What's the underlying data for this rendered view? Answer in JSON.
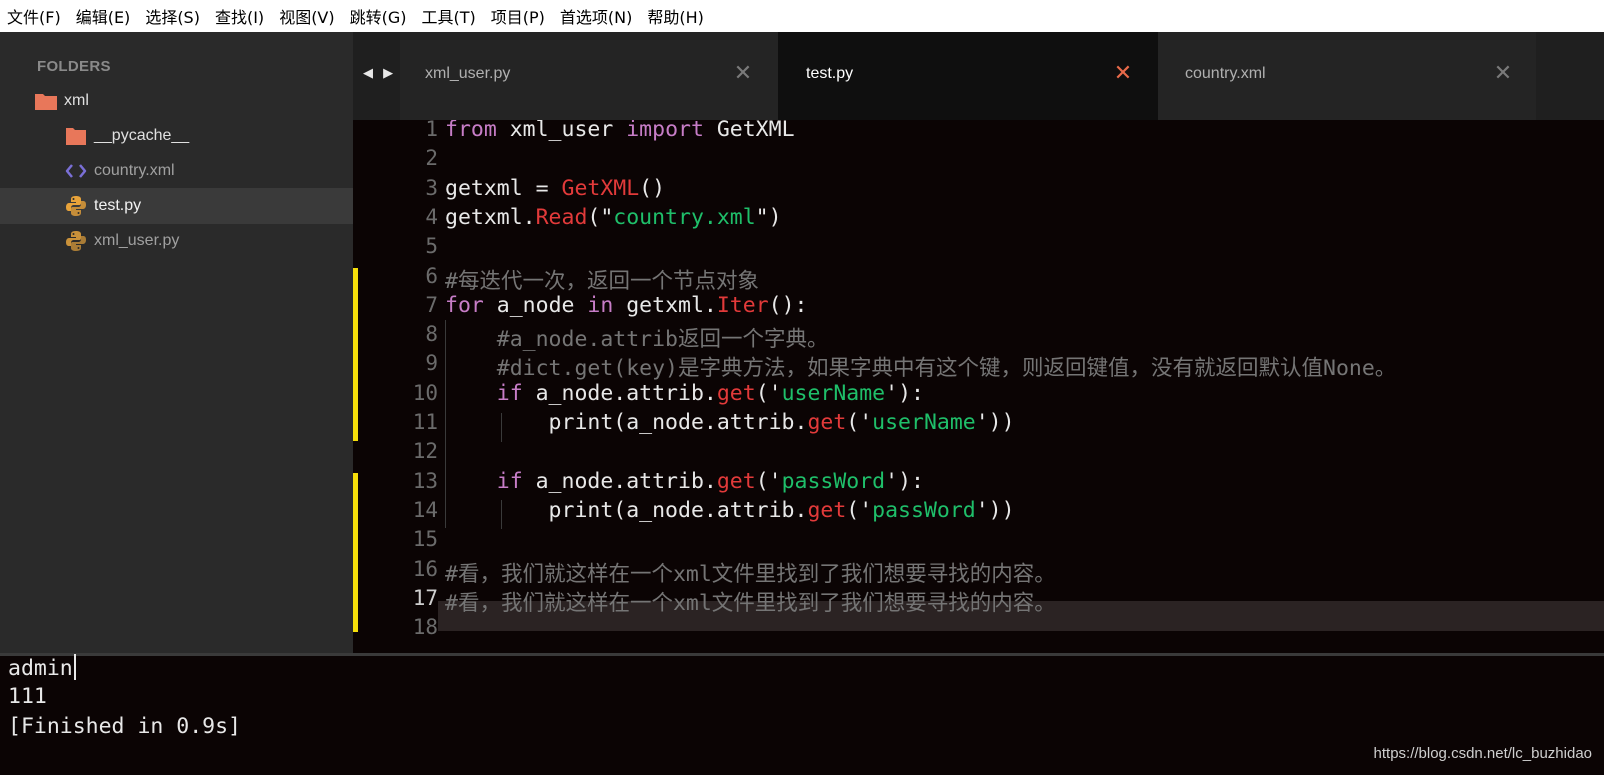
{
  "menubar": {
    "items": [
      "文件(F)",
      "编辑(E)",
      "选择(S)",
      "查找(I)",
      "视图(V)",
      "跳转(G)",
      "工具(T)",
      "项目(P)",
      "首选项(N)",
      "帮助(H)"
    ]
  },
  "sidebar": {
    "header": "FOLDERS",
    "tree": [
      {
        "label": "xml",
        "icon": "folder-icon"
      },
      {
        "label": "__pycache__",
        "icon": "folder-icon"
      },
      {
        "label": "country.xml",
        "icon": "code-file-icon"
      },
      {
        "label": "test.py",
        "icon": "python-icon"
      },
      {
        "label": "xml_user.py",
        "icon": "python-icon"
      }
    ]
  },
  "tabs": {
    "nav": "◀ ▶",
    "close_glyph": "✕",
    "items": [
      {
        "label": "xml_user.py",
        "active": false
      },
      {
        "label": "test.py",
        "active": true
      },
      {
        "label": "country.xml",
        "active": false
      }
    ]
  },
  "editor": {
    "line_numbers": [
      "1",
      "2",
      "3",
      "4",
      "5",
      "6",
      "7",
      "8",
      "9",
      "10",
      "11",
      "12",
      "13",
      "14",
      "15",
      "16",
      "17",
      "18"
    ],
    "active_line": "17",
    "code": [
      [
        {
          "t": "kw",
          "v": "from"
        },
        {
          "t": "plain",
          "v": " xml_user "
        },
        {
          "t": "kw",
          "v": "import"
        },
        {
          "t": "plain",
          "v": " GetXML"
        }
      ],
      [],
      [
        {
          "t": "plain",
          "v": "getxml = "
        },
        {
          "t": "fn",
          "v": "GetXML"
        },
        {
          "t": "plain",
          "v": "()"
        }
      ],
      [
        {
          "t": "plain",
          "v": "getxml."
        },
        {
          "t": "fn",
          "v": "Read"
        },
        {
          "t": "plain",
          "v": "(\""
        },
        {
          "t": "str",
          "v": "country.xml"
        },
        {
          "t": "plain",
          "v": "\")"
        }
      ],
      [],
      [
        {
          "t": "cm",
          "v": "#每迭代一次，返回一个节点对象"
        }
      ],
      [
        {
          "t": "kw",
          "v": "for"
        },
        {
          "t": "plain",
          "v": " a_node "
        },
        {
          "t": "kw",
          "v": "in"
        },
        {
          "t": "plain",
          "v": " getxml."
        },
        {
          "t": "fn",
          "v": "Iter"
        },
        {
          "t": "plain",
          "v": "():"
        }
      ],
      [
        {
          "t": "plain",
          "v": "    "
        },
        {
          "t": "cm",
          "v": "#a_node.attrib返回一个字典。"
        }
      ],
      [
        {
          "t": "plain",
          "v": "    "
        },
        {
          "t": "cm",
          "v": "#dict.get(key)是字典方法，如果字典中有这个键，则返回键值，没有就返回默认值None。"
        }
      ],
      [
        {
          "t": "plain",
          "v": "    "
        },
        {
          "t": "kw",
          "v": "if"
        },
        {
          "t": "plain",
          "v": " a_node.attrib."
        },
        {
          "t": "fn",
          "v": "get"
        },
        {
          "t": "plain",
          "v": "('"
        },
        {
          "t": "str",
          "v": "userName"
        },
        {
          "t": "plain",
          "v": "'):"
        }
      ],
      [
        {
          "t": "plain",
          "v": "        print(a_node.attrib."
        },
        {
          "t": "fn",
          "v": "get"
        },
        {
          "t": "plain",
          "v": "('"
        },
        {
          "t": "str",
          "v": "userName"
        },
        {
          "t": "plain",
          "v": "'))"
        }
      ],
      [],
      [
        {
          "t": "plain",
          "v": "    "
        },
        {
          "t": "kw",
          "v": "if"
        },
        {
          "t": "plain",
          "v": " a_node.attrib."
        },
        {
          "t": "fn",
          "v": "get"
        },
        {
          "t": "plain",
          "v": "('"
        },
        {
          "t": "str",
          "v": "passWord"
        },
        {
          "t": "plain",
          "v": "'):"
        }
      ],
      [
        {
          "t": "plain",
          "v": "        print(a_node.attrib."
        },
        {
          "t": "fn",
          "v": "get"
        },
        {
          "t": "plain",
          "v": "('"
        },
        {
          "t": "str",
          "v": "passWord"
        },
        {
          "t": "plain",
          "v": "'))"
        }
      ],
      [],
      [
        {
          "t": "cm",
          "v": "#看，我们就这样在一个xml文件里找到了我们想要寻找的内容。"
        }
      ],
      [
        {
          "t": "cm",
          "v": "#看，我们就这样在一个xml文件里找到了我们想要寻找的内容。"
        }
      ],
      []
    ]
  },
  "output": {
    "lines": [
      "admin",
      "111",
      "[Finished in 0.9s]"
    ]
  },
  "watermark": "https://blog.csdn.net/lc_buzhidao",
  "colors": {
    "keyword": "#c77dc7",
    "function": "#e23a3a",
    "string": "#1fbf6a",
    "comment": "#757575",
    "modified_marker": "#f5de0a",
    "folder": "#e8775a",
    "python": "#e8a33a",
    "xml_icon": "#7a6fd6",
    "active_close": "#e86a4a"
  }
}
